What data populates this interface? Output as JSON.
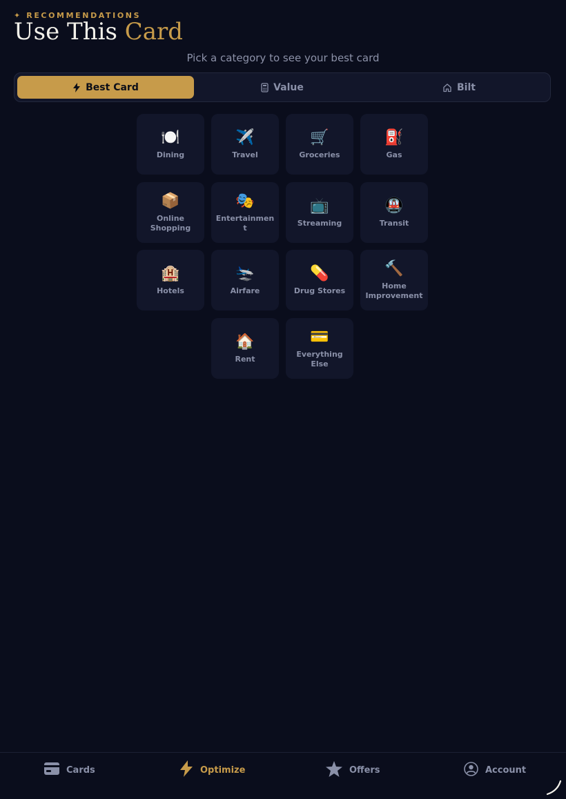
{
  "header": {
    "eyebrow": "✦ RECOMMENDATIONS",
    "title_main": "Use This ",
    "title_accent": "Card",
    "subtitle": "Pick a category to see your best card"
  },
  "tabs": [
    {
      "label": "Best Card",
      "icon": "bolt-icon",
      "active": true
    },
    {
      "label": "Value",
      "icon": "calculator-icon",
      "active": false
    },
    {
      "label": "Bilt",
      "icon": "home-icon",
      "active": false
    }
  ],
  "categories": [
    {
      "label": "Dining",
      "emoji": "🍽️"
    },
    {
      "label": "Travel",
      "emoji": "✈️"
    },
    {
      "label": "Groceries",
      "emoji": "🛒"
    },
    {
      "label": "Gas",
      "emoji": "⛽"
    },
    {
      "label": "Online Shopping",
      "emoji": "📦"
    },
    {
      "label": "Entertainment",
      "emoji": "🎭"
    },
    {
      "label": "Streaming",
      "emoji": "📺"
    },
    {
      "label": "Transit",
      "emoji": "🚇"
    },
    {
      "label": "Hotels",
      "emoji": "🏨"
    },
    {
      "label": "Airfare",
      "emoji": "🛬"
    },
    {
      "label": "Drug Stores",
      "emoji": "💊"
    },
    {
      "label": "Home Improvement",
      "emoji": "🔨"
    },
    {
      "label": "Rent",
      "emoji": "🏠"
    },
    {
      "label": "Everything Else",
      "emoji": "💳"
    }
  ],
  "nav": [
    {
      "label": "Cards",
      "icon": "card-icon",
      "active": false
    },
    {
      "label": "Optimize",
      "icon": "bolt-icon",
      "active": true
    },
    {
      "label": "Offers",
      "icon": "star-icon",
      "active": false
    },
    {
      "label": "Account",
      "icon": "user-circle-icon",
      "active": false
    }
  ],
  "colors": {
    "background": "#0a0d1c",
    "tile": "#12162a",
    "accent": "#c79b4a",
    "muted_text": "#8a90a8"
  }
}
